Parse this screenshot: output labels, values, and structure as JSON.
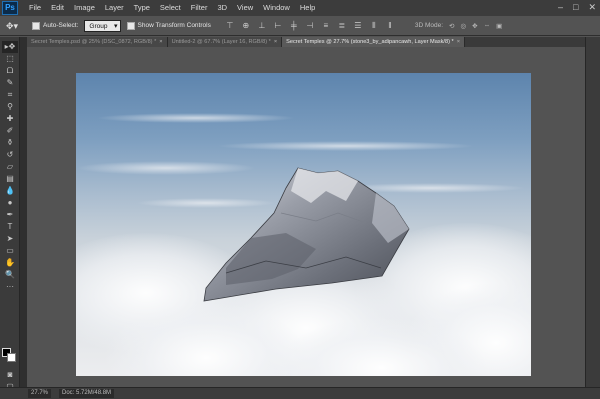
{
  "app": {
    "logo": "Ps",
    "menu": [
      "File",
      "Edit",
      "Image",
      "Layer",
      "Type",
      "Select",
      "Filter",
      "3D",
      "View",
      "Window",
      "Help"
    ],
    "window_controls": [
      "–",
      "□",
      "✕"
    ]
  },
  "options": {
    "tool_icon": "move-tool-icon",
    "auto_select_label": "Auto-Select:",
    "auto_select_value": "Group",
    "transform_label": "Show Transform Controls",
    "mode_3d_label": "3D Mode:"
  },
  "tabs": [
    {
      "label": "Secret Temples.psd @ 25% (DSC_0872, RGB/8) *"
    },
    {
      "label": "Untitled-2 @ 67.7% (Layer 16, RGB/8) *"
    },
    {
      "label": "Secret Temples @ 27.7% (stone3_by_adipancawh, Layer Mask/8) *"
    }
  ],
  "tools": [
    "move-tool-icon",
    "marquee-tool-icon",
    "lasso-tool-icon",
    "quick-select-icon",
    "crop-tool-icon",
    "eyedropper-icon",
    "healing-brush-icon",
    "brush-tool-icon",
    "clone-stamp-icon",
    "history-brush-icon",
    "eraser-icon",
    "gradient-tool-icon",
    "blur-tool-icon",
    "dodge-tool-icon",
    "pen-tool-icon",
    "type-tool-icon",
    "path-select-icon",
    "shape-tool-icon",
    "hand-tool-icon",
    "zoom-tool-icon"
  ],
  "status": {
    "zoom": "27.7%",
    "doc": "Doc: 5.72M/48.8M"
  },
  "colors": {
    "foreground": "#000000",
    "background": "#ffffff",
    "accent": "#32a1ff"
  }
}
